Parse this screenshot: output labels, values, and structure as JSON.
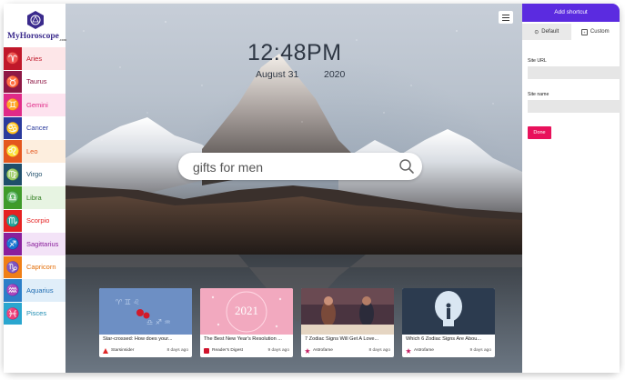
{
  "app": {
    "brand": "MyHoroscope",
    "brand_suffix": ".com"
  },
  "sidebar": {
    "items": [
      {
        "label": "Aries",
        "icon": "aries-icon",
        "glyph": "♈",
        "color": "#c0182a",
        "bg": "#fde6e8",
        "text": "#c0182a"
      },
      {
        "label": "Taurus",
        "icon": "taurus-icon",
        "glyph": "♉",
        "color": "#8e1845",
        "bg": "#ffffff",
        "text": "#8e1845"
      },
      {
        "label": "Gemini",
        "icon": "gemini-icon",
        "glyph": "♊",
        "color": "#e02a88",
        "bg": "#fde3ef",
        "text": "#e02a88"
      },
      {
        "label": "Cancer",
        "icon": "cancer-icon",
        "glyph": "♋",
        "color": "#2a3a9c",
        "bg": "#ffffff",
        "text": "#2a3a9c"
      },
      {
        "label": "Leo",
        "icon": "leo-icon",
        "glyph": "♌",
        "color": "#e4571e",
        "bg": "#fdeede",
        "text": "#e4571e"
      },
      {
        "label": "Virgo",
        "icon": "virgo-icon",
        "glyph": "♍",
        "color": "#1f4e6a",
        "bg": "#ffffff",
        "text": "#1f4e6a"
      },
      {
        "label": "Libra",
        "icon": "libra-icon",
        "glyph": "♎",
        "color": "#3f9b2a",
        "bg": "#e7f4e2",
        "text": "#2f7d1e"
      },
      {
        "label": "Scorpio",
        "icon": "scorpio-icon",
        "glyph": "♏",
        "color": "#e52222",
        "bg": "#ffffff",
        "text": "#e52222"
      },
      {
        "label": "Sagittarius",
        "icon": "sagittarius-icon",
        "glyph": "♐",
        "color": "#8a1f9c",
        "bg": "#f3e3f7",
        "text": "#8a1f9c"
      },
      {
        "label": "Capricorn",
        "icon": "capricorn-icon",
        "glyph": "♑",
        "color": "#f07f16",
        "bg": "#ffffff",
        "text": "#e36d06"
      },
      {
        "label": "Aquarius",
        "icon": "aquarius-icon",
        "glyph": "♒",
        "color": "#2c7fc8",
        "bg": "#e0eef9",
        "text": "#1f6cb2"
      },
      {
        "label": "Pisces",
        "icon": "pisces-icon",
        "glyph": "♓",
        "color": "#2aa6cf",
        "bg": "#ffffff",
        "text": "#1f8db3"
      }
    ]
  },
  "clock": {
    "time": "12:48PM",
    "date": "August 31",
    "year": "2020"
  },
  "search": {
    "value": "gifts for men"
  },
  "cards": [
    {
      "title": "Star-crossed: How does your...",
      "source": "Starsinsider",
      "age": "8 days ago",
      "thumb_color": "#6d8fc4",
      "source_color": "#e02929"
    },
    {
      "title": "The Best New Year's Resolution ...",
      "source": "Reader's Digest",
      "age": "9 days ago",
      "thumb_color": "#f2a9bf",
      "thumb_text": "2021",
      "source_color": "#d0142c"
    },
    {
      "title": "7 Zodiac Signs Will Get A Love...",
      "source": "Astrofame",
      "age": "8 days ago",
      "thumb_color": "#4a3440",
      "source_color": "#c21b5f"
    },
    {
      "title": "Which 6 Zodiac Signs Are Abou...",
      "source": "Astrofame",
      "age": "9 days ago",
      "thumb_color": "#2c3b4f",
      "source_color": "#c21b5f"
    }
  ],
  "panel": {
    "header": "Add shortcut",
    "tabs": [
      {
        "label": "Default"
      },
      {
        "label": "Custom"
      }
    ],
    "site_url_label": "Site URL",
    "site_url_value": "",
    "site_name_label": "Site name",
    "site_name_value": "",
    "done_label": "Done"
  },
  "colors": {
    "accent": "#5b2be0",
    "done": "#e8115b"
  }
}
